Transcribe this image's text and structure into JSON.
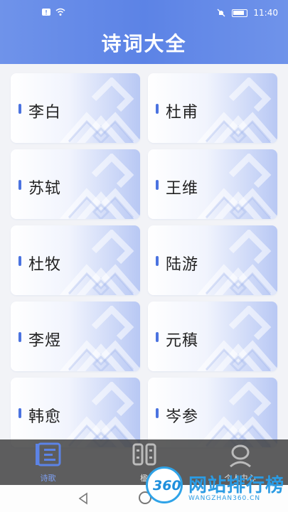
{
  "status_bar": {
    "time": "11:40"
  },
  "header": {
    "title": "诗词大全"
  },
  "poets": [
    {
      "name": "李白"
    },
    {
      "name": "杜甫"
    },
    {
      "name": "苏轼"
    },
    {
      "name": "王维"
    },
    {
      "name": "杜牧"
    },
    {
      "name": "陆游"
    },
    {
      "name": "李煜"
    },
    {
      "name": "元稹"
    },
    {
      "name": "韩愈"
    },
    {
      "name": "岑参"
    }
  ],
  "tabbar": {
    "tabs": [
      {
        "label": "诗歌",
        "icon": "book-icon",
        "active": true
      },
      {
        "label": "楹",
        "icon": "couplet-icon",
        "active": false
      },
      {
        "label": "个人中心",
        "icon": "person-icon",
        "active": false
      }
    ]
  },
  "watermark": {
    "number": "360",
    "text": "网站排行榜",
    "url": "WANGZHAN360.CN"
  },
  "colors": {
    "accent": "#5c83e6",
    "bar": "#4b73e0",
    "tab_active": "#7ea0f2"
  }
}
